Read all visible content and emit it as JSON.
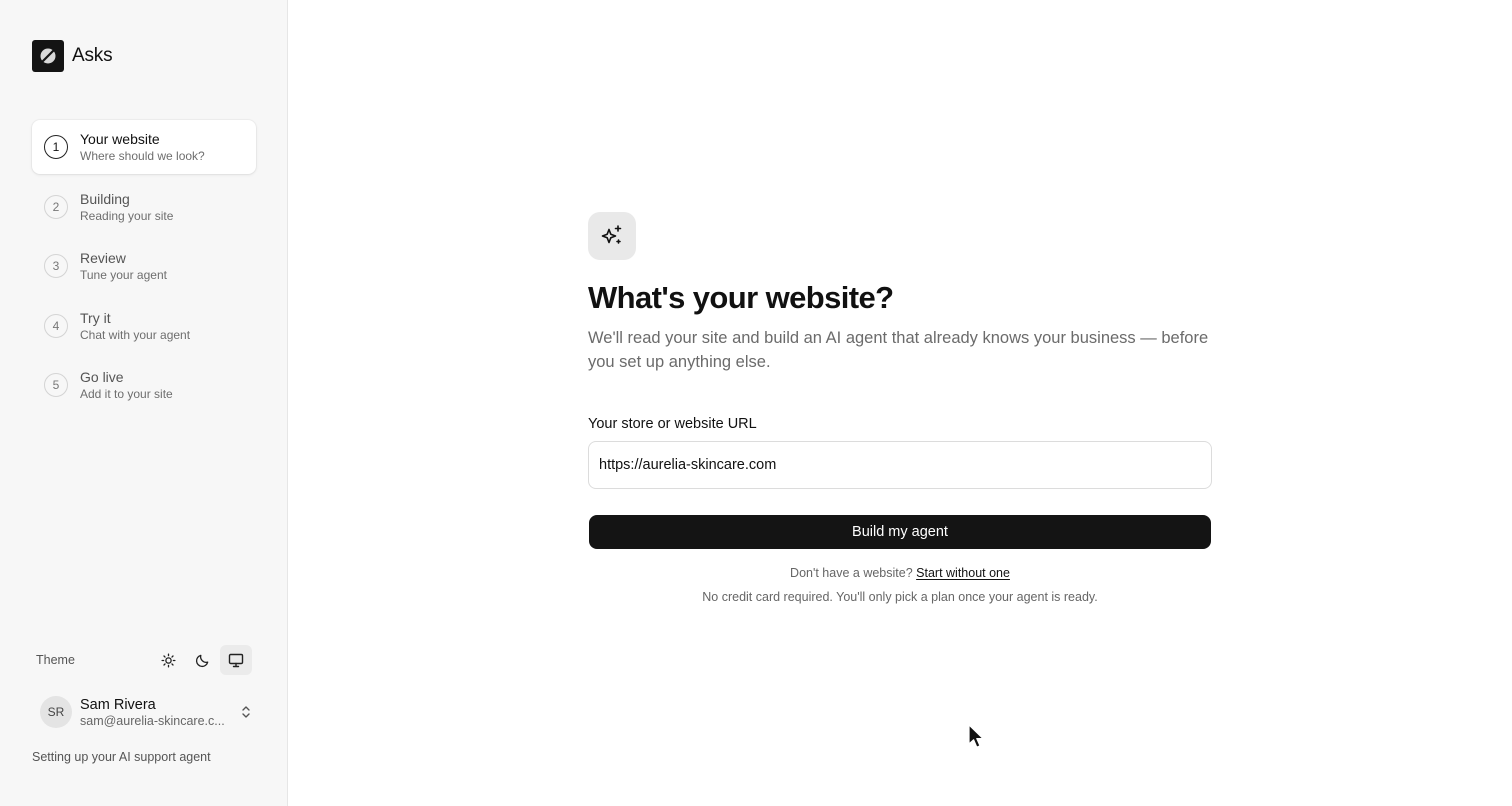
{
  "brand": {
    "name": "Asks"
  },
  "steps": [
    {
      "number": "1",
      "title": "Your website",
      "subtitle": "Where should we look?",
      "active": true
    },
    {
      "number": "2",
      "title": "Building",
      "subtitle": "Reading your site",
      "active": false
    },
    {
      "number": "3",
      "title": "Review",
      "subtitle": "Tune your agent",
      "active": false
    },
    {
      "number": "4",
      "title": "Try it",
      "subtitle": "Chat with your agent",
      "active": false
    },
    {
      "number": "5",
      "title": "Go live",
      "subtitle": "Add it to your site",
      "active": false
    }
  ],
  "theme": {
    "label": "Theme",
    "options": [
      "sun-icon",
      "moon-icon",
      "monitor-icon"
    ],
    "selected": "monitor-icon"
  },
  "user": {
    "initials": "SR",
    "name": "Sam Rivera",
    "email": "sam@aurelia-skincare.c..."
  },
  "footer_note": "Setting up your AI support agent",
  "main": {
    "icon": "sparkles-icon",
    "headline": "What's your website?",
    "subtitle": "We'll read your site and build an AI agent that already knows your business — before you set up anything else.",
    "url_label": "Your store or website URL",
    "url_value": "https://aurelia-skincare.com",
    "build_button": "Build my agent",
    "no_site_prefix": "Don't have a website?",
    "no_site_link": "Start without one",
    "no_credit_card": "No credit card required. You'll only pick a plan once your agent is ready."
  },
  "colors": {
    "accent": "#141414",
    "sidebar_bg": "#f7f7f7",
    "muted_text": "#6b6b6b"
  }
}
